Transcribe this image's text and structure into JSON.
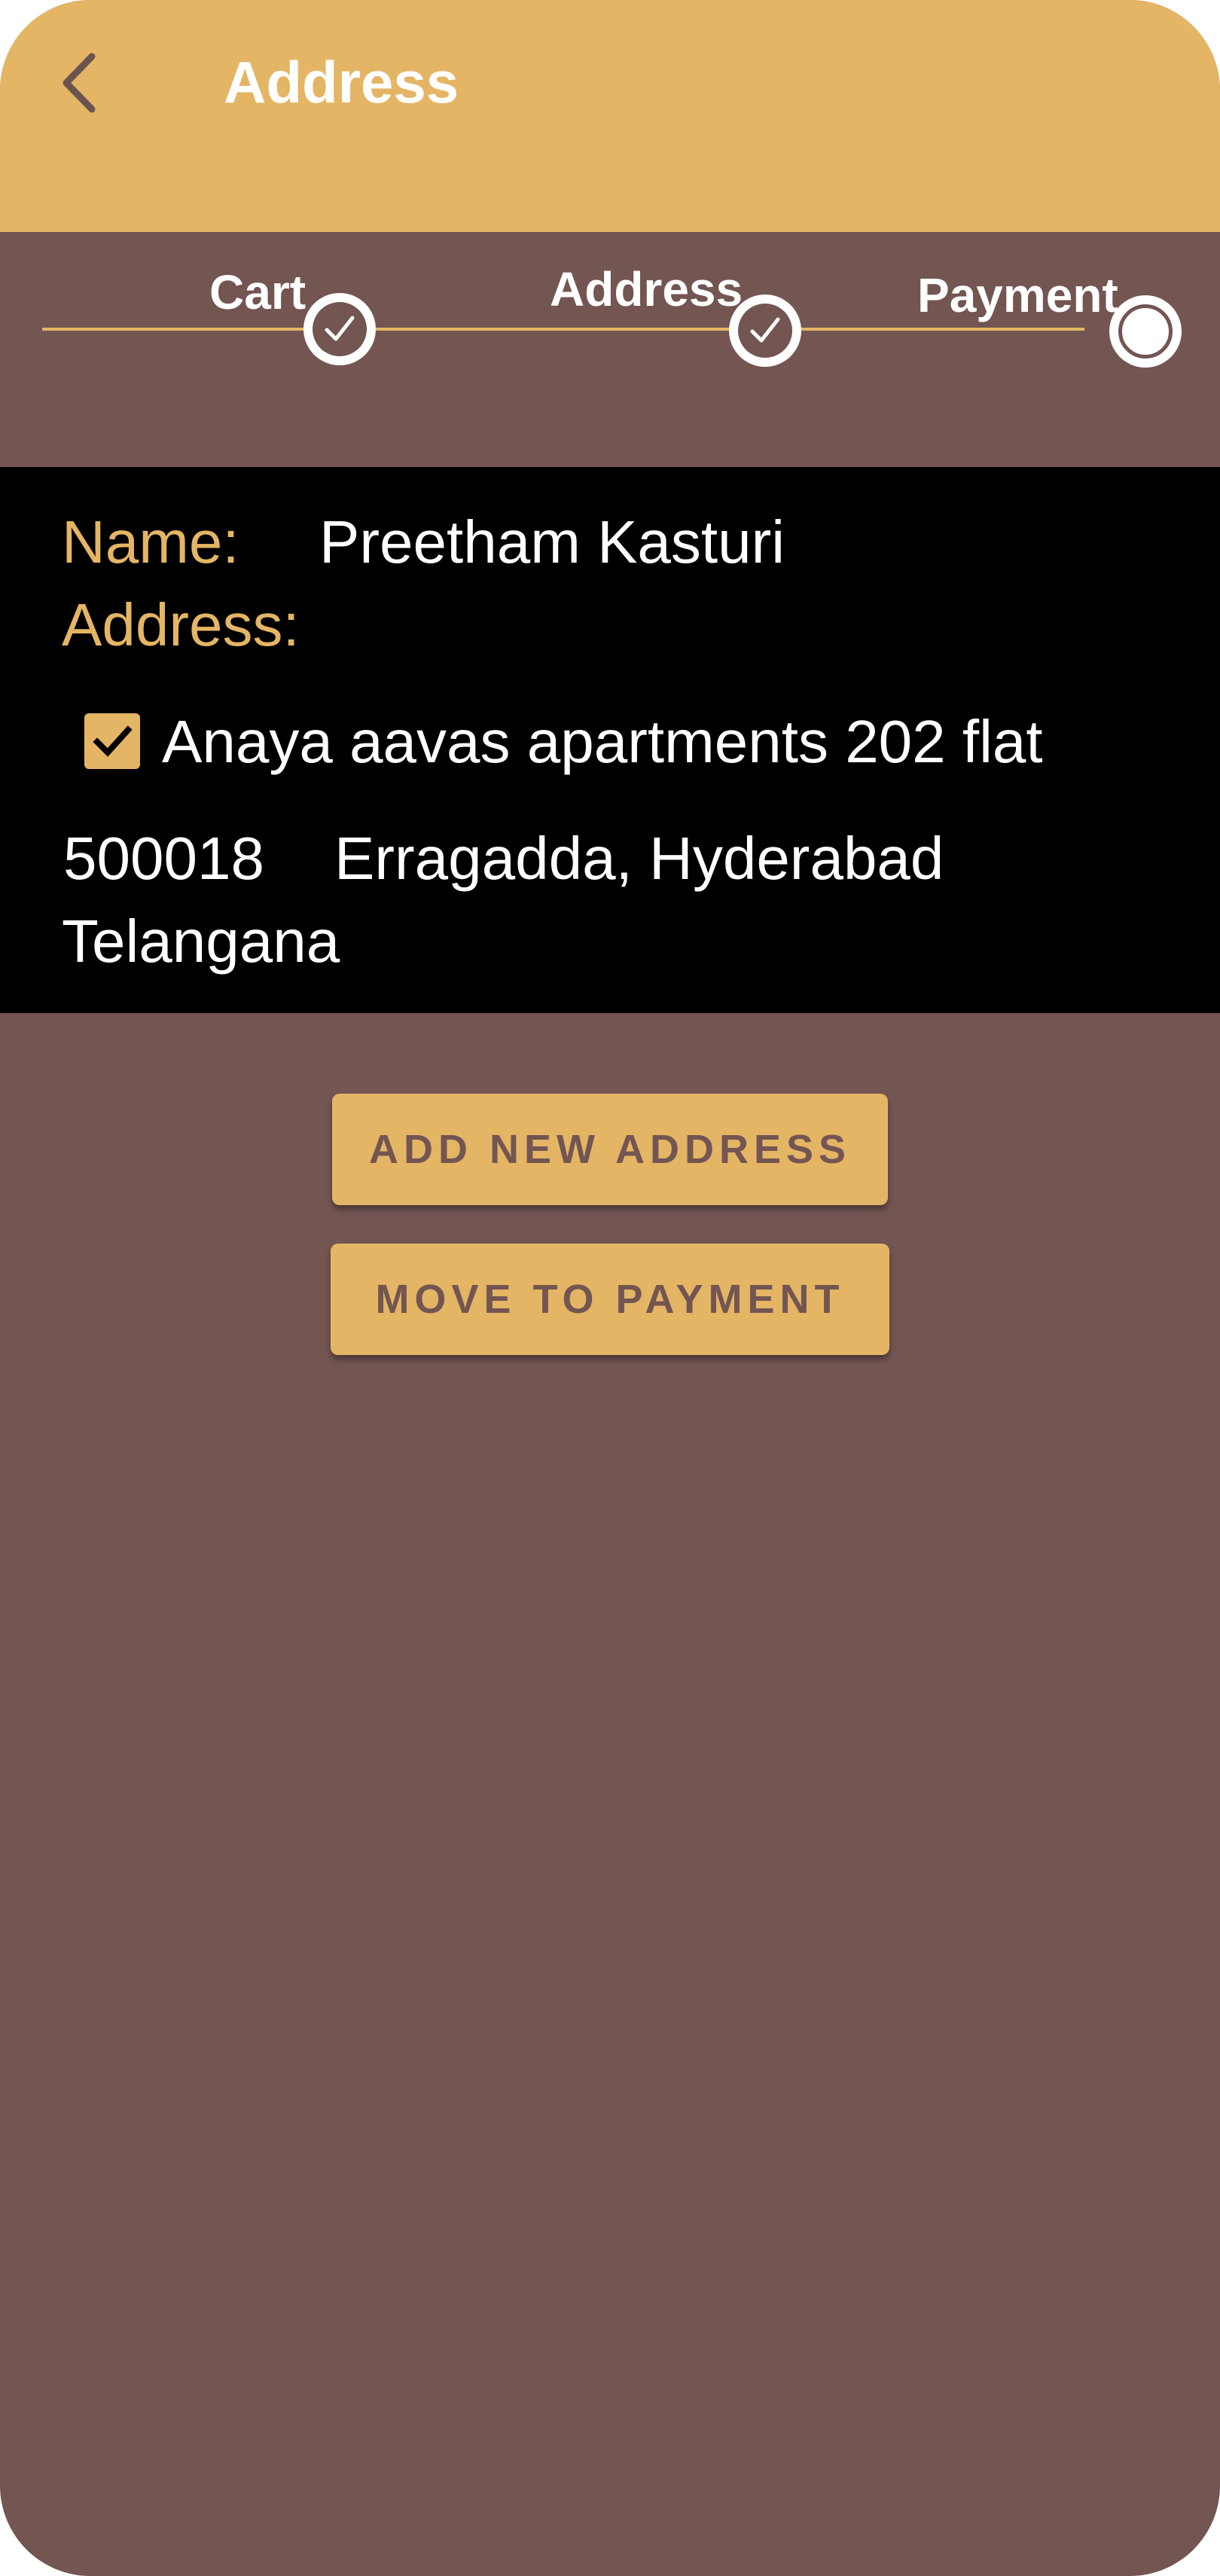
{
  "app_bar": {
    "title": "Address",
    "back_icon": "chevron-left-icon"
  },
  "stepper": {
    "steps": [
      {
        "label": "Cart",
        "status": "done"
      },
      {
        "label": "Address",
        "status": "done"
      },
      {
        "label": "Payment",
        "status": "pending"
      }
    ]
  },
  "address_card": {
    "name_label": "Name:",
    "name_value": "Preetham Kasturi",
    "address_label": "Address:",
    "address_line": "Anaya aavas apartments 202 flat",
    "address_checked": true,
    "pincode": "500018",
    "city": "Erragadda, Hyderabad",
    "state": "Telangana"
  },
  "buttons": {
    "add_new_address": "ADD NEW ADDRESS",
    "move_to_payment": "MOVE TO PAYMENT"
  },
  "colors": {
    "accent": "#e4b564",
    "background": "#735552",
    "card": "#000000",
    "text_light": "#ffffff"
  }
}
